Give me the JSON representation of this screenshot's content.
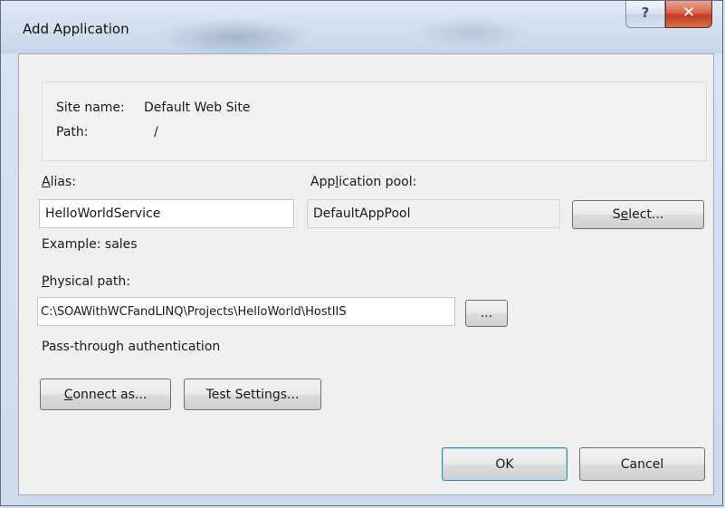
{
  "window": {
    "title": "Add Application",
    "help_glyph": "?",
    "close_glyph": "✕"
  },
  "site": {
    "name_label": "Site name:",
    "name_value": "Default Web Site",
    "path_label": "Path:",
    "path_value": "/"
  },
  "alias": {
    "label": "Alias:",
    "value": "HelloWorldService",
    "example": "Example: sales"
  },
  "app_pool": {
    "label": "Application pool:",
    "value": "DefaultAppPool",
    "select_label": "Select..."
  },
  "physical_path": {
    "label": "Physical path:",
    "value": "C:\\SOAWithWCFandLINQ\\Projects\\HelloWorld\\HostIIS",
    "browse_label": "..."
  },
  "auth": {
    "label": "Pass-through authentication"
  },
  "buttons": {
    "connect_as": "Connect as...",
    "test_settings": "Test Settings...",
    "ok": "OK",
    "cancel": "Cancel"
  },
  "colors": {
    "close_button": "#c1391e",
    "dialog_background": "#f0f0f0",
    "frame": "#c6d6ea"
  }
}
